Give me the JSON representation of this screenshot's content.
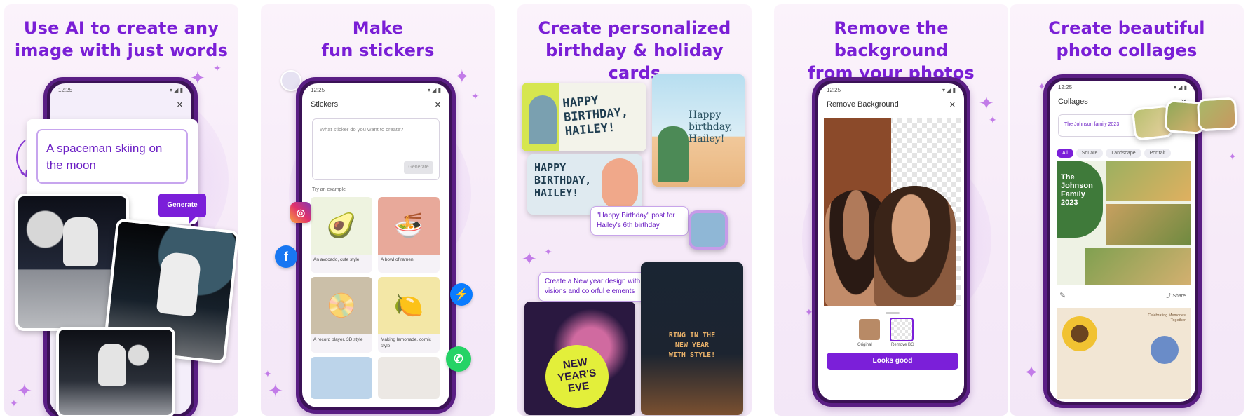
{
  "panels": [
    {
      "title": "Use AI to create any\nimage with just words",
      "status_time": "12:25",
      "prompt_text": "A spaceman skiing on the moon",
      "generate_label": "Generate"
    },
    {
      "title": "Make\nfun stickers",
      "status_time": "12:25",
      "screen_title": "Stickers",
      "input_placeholder": "What sticker do you want to create?",
      "generate_label": "Generate",
      "examples_label": "Try an example",
      "tiles": [
        {
          "caption": "An avocado, cute style"
        },
        {
          "caption": "A bowl of ramen"
        },
        {
          "caption": "A record player, 3D style"
        },
        {
          "caption": "Making lemonade, comic style"
        }
      ],
      "social_icons": [
        "instagram-icon",
        "facebook-icon",
        "messenger-icon",
        "whatsapp-icon"
      ]
    },
    {
      "title": "Create personalized\nbirthday & holiday cards",
      "card1_text": "HAPPY\nBIRTHDAY,\nHAILEY!",
      "card2_text": "Happy\nbirthday,\nHailey!",
      "card3_text": "HAPPY\nBIRTHDAY,\nHAILEY!",
      "prompt1": "\"Happy Birthday\" post for Hailey's 6th birthday",
      "prompt2": "Create a New year design with visions and colorful elements",
      "card4_text": "NEW\nYEAR'S\nEVE",
      "card5_text": "RING IN THE\nNEW YEAR\nWITH STYLE!"
    },
    {
      "title": "Remove the background\nfrom your photos",
      "status_time": "12:25",
      "screen_title": "Remove Background",
      "thumb_labels": [
        "Original",
        "Remove BG"
      ],
      "looks_good_label": "Looks good"
    },
    {
      "title": "Create beautiful\nphoto collages",
      "status_time": "12:25",
      "screen_title": "Collages",
      "input_value": "The Johnson family 2023",
      "chips": [
        "All",
        "Square",
        "Landscape",
        "Portrait"
      ],
      "collage_title": "The\nJohnson\nFamily\n2023",
      "share_label": "Share",
      "collage2_caption": "Celebrating Memories\nTogether"
    }
  ],
  "colors": {
    "accent": "#7b1fd9",
    "title": "#7a1fd6",
    "phone_frame": "#5a1e84"
  }
}
